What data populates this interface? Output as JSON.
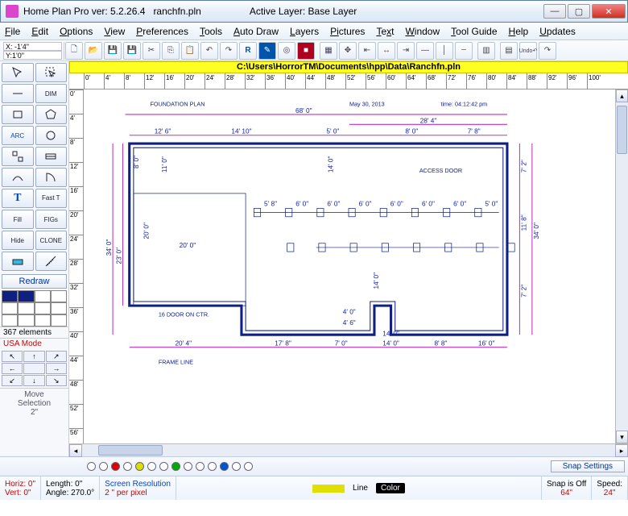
{
  "window": {
    "title_prefix": "Home Plan Pro ver: 5.2.26.4",
    "filename": "ranchfn.pln",
    "active_layer_label": "Active Layer:",
    "active_layer": "Base Layer"
  },
  "menu": [
    "File",
    "Edit",
    "Options",
    "View",
    "Preferences",
    "Tools",
    "Auto Draw",
    "Layers",
    "Pictures",
    "Text",
    "Window",
    "Tool Guide",
    "Help",
    "Updates"
  ],
  "coords": {
    "x_label": "X: -1'4\"",
    "y_label": "Y:1'0\""
  },
  "toolbar_icons": [
    "new",
    "open",
    "save",
    "save-all",
    "cut",
    "copy",
    "paste",
    "undo",
    "redo",
    "registered",
    "pointer",
    "target",
    "stop",
    "sep",
    "grid",
    "snap",
    "align-l",
    "align-c",
    "align-r",
    "align-t",
    "align-m",
    "align-b",
    "sep",
    "bars",
    "sep",
    "chart",
    "undo2",
    "redo2"
  ],
  "path": "C:\\Users\\HorrorTM\\Documents\\hpp\\Data\\Ranchfn.pln",
  "hruler_ticks": [
    "0'",
    "4'",
    "8'",
    "12'",
    "16'",
    "20'",
    "24'",
    "28'",
    "32'",
    "36'",
    "40'",
    "44'",
    "48'",
    "52'",
    "56'",
    "60'",
    "64'",
    "68'",
    "72'",
    "76'",
    "80'",
    "84'",
    "88'",
    "92'",
    "96'",
    "100'"
  ],
  "vruler_ticks": [
    "0'",
    "4'",
    "8'",
    "12'",
    "16'",
    "20'",
    "24'",
    "28'",
    "32'",
    "36'",
    "40'",
    "44'",
    "48'",
    "52'",
    "56'"
  ],
  "left_tools": [
    {
      "name": "pointer",
      "label": ""
    },
    {
      "name": "select",
      "label": ""
    },
    {
      "name": "line",
      "label": ""
    },
    {
      "name": "dim",
      "label": "DIM"
    },
    {
      "name": "rect",
      "label": ""
    },
    {
      "name": "poly",
      "label": ""
    },
    {
      "name": "arc",
      "label": "ARC"
    },
    {
      "name": "circle",
      "label": ""
    },
    {
      "name": "wall",
      "label": ""
    },
    {
      "name": "wall2",
      "label": ""
    },
    {
      "name": "curve",
      "label": ""
    },
    {
      "name": "door",
      "label": ""
    },
    {
      "name": "text",
      "label": "T"
    },
    {
      "name": "fast-text",
      "label": "Fast T"
    },
    {
      "name": "fill",
      "label": "Fill"
    },
    {
      "name": "figs",
      "label": "FIGs"
    },
    {
      "name": "hide",
      "label": "Hide"
    },
    {
      "name": "clone",
      "label": "CLONE"
    },
    {
      "name": "paint",
      "label": ""
    },
    {
      "name": "measure",
      "label": ""
    }
  ],
  "redraw_label": "Redraw",
  "elements_label": "367 elements",
  "mode_label": "USA Mode",
  "move_sel": {
    "l1": "Move",
    "l2": "Selection",
    "l3": "2\""
  },
  "snap_settings_label": "Snap Settings",
  "status": {
    "horiz": "Horiz: 0\"",
    "vert": "Vert:  0\"",
    "length": "Length:  0\"",
    "angle": "Angle: 270.0°",
    "resolution_label": "Screen Resolution",
    "resolution": "2 \" per pixel",
    "line_label": "Line",
    "color_label": "Color",
    "snap_label": "Snap is Off",
    "snap_val": "64\"",
    "speed_label": "Speed:",
    "speed_val": "24\""
  },
  "plan": {
    "title": "FOUNDATION PLAN",
    "date": "May 30, 2013",
    "time": "time: 04:12:42 pm",
    "frame_line": "FRAME LINE",
    "access_door": "ACCESS DOOR",
    "door_ctr": "16 DOOR ON CTR.",
    "dims": {
      "overall_w": "68' 0\"",
      "right_w": "28' 4\"",
      "top_a": "12' 6\"",
      "top_b": "14' 10\"",
      "top_c": "5' 0\"",
      "top_d": "8' 0\"",
      "top_e": "7' 8\"",
      "left_h": "34' 0\"",
      "left_in": "8' 0\"",
      "gar_h": "23' 0\"",
      "gar_w": "20' 0\"",
      "eleven": "11' 0\"",
      "right_h": "34' 0\"",
      "right_a": "7' 2\"",
      "right_b": "11' 8\"",
      "right_c": "7' 2\"",
      "bot_a": "20' 4\"",
      "bot_b": "17' 8\"",
      "bot_c": "7' 0\"",
      "bot_d": "14' 0\"",
      "bot_e": "8' 8\"",
      "bot_f": "16' 0\"",
      "mid_span": [
        "5' 8\"",
        "6' 0\"",
        "6' 0\"",
        "6' 0\"",
        "6' 0\"",
        "6' 0\"",
        "6' 0\"",
        "5' 0\""
      ],
      "notch_h": "14' 0\"",
      "notch_w": "4' 0\"",
      "notch_h2": "14' 0\"",
      "notch_x": "4' 6\"",
      "twenty": "20' 0\""
    }
  },
  "colors": {
    "accent": "#102080",
    "dim": "#c030c0"
  }
}
